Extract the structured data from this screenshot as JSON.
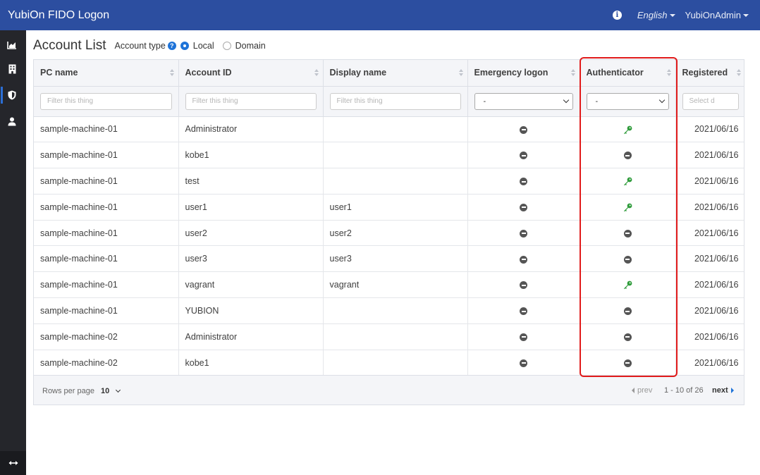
{
  "app": {
    "title": "YubiOn FIDO Logon"
  },
  "topbar": {
    "language": "English",
    "user": "YubiOnAdmin"
  },
  "sidebar": {
    "items": [
      {
        "icon": "chart-area-icon"
      },
      {
        "icon": "building-icon"
      },
      {
        "icon": "shield-icon"
      },
      {
        "icon": "user-icon"
      }
    ],
    "bottom_icon": "expand-arrows-icon"
  },
  "page": {
    "title": "Account List",
    "account_type_label": "Account type",
    "account_type_options": [
      "Local",
      "Domain"
    ],
    "account_type_selected": "Local"
  },
  "table": {
    "columns": [
      "PC name",
      "Account ID",
      "Display name",
      "Emergency logon",
      "Authenticator",
      "Registered"
    ],
    "filters": {
      "text_placeholder": "Filter this thing",
      "emergency_value": "-",
      "authenticator_value": "-",
      "date_placeholder": "Select d"
    },
    "rows": [
      {
        "pc": "sample-machine-01",
        "account": "Administrator",
        "display": "",
        "emergency": "minus",
        "auth": "key",
        "registered": "2021/06/16"
      },
      {
        "pc": "sample-machine-01",
        "account": "kobe1",
        "display": "",
        "emergency": "minus",
        "auth": "minus",
        "registered": "2021/06/16"
      },
      {
        "pc": "sample-machine-01",
        "account": "test",
        "display": "",
        "emergency": "minus",
        "auth": "key",
        "registered": "2021/06/16"
      },
      {
        "pc": "sample-machine-01",
        "account": "user1",
        "display": "user1",
        "emergency": "minus",
        "auth": "key",
        "registered": "2021/06/16"
      },
      {
        "pc": "sample-machine-01",
        "account": "user2",
        "display": "user2",
        "emergency": "minus",
        "auth": "minus",
        "registered": "2021/06/16"
      },
      {
        "pc": "sample-machine-01",
        "account": "user3",
        "display": "user3",
        "emergency": "minus",
        "auth": "minus",
        "registered": "2021/06/16"
      },
      {
        "pc": "sample-machine-01",
        "account": "vagrant",
        "display": "vagrant",
        "emergency": "minus",
        "auth": "key",
        "registered": "2021/06/16"
      },
      {
        "pc": "sample-machine-01",
        "account": "YUBION",
        "display": "",
        "emergency": "minus",
        "auth": "minus",
        "registered": "2021/06/16"
      },
      {
        "pc": "sample-machine-02",
        "account": "Administrator",
        "display": "",
        "emergency": "minus",
        "auth": "minus",
        "registered": "2021/06/16"
      },
      {
        "pc": "sample-machine-02",
        "account": "kobe1",
        "display": "",
        "emergency": "minus",
        "auth": "minus",
        "registered": "2021/06/16"
      }
    ]
  },
  "pagination": {
    "rows_per_page_label": "Rows per page",
    "rows_per_page": "10",
    "prev": "prev",
    "range": "1 - 10 of 26",
    "next": "next"
  },
  "colors": {
    "topbar": "#2c4ea0",
    "sidebar": "#25262b",
    "accent": "#1e73d8",
    "key": "#2e9b3a",
    "highlight": "#e11b1b"
  }
}
